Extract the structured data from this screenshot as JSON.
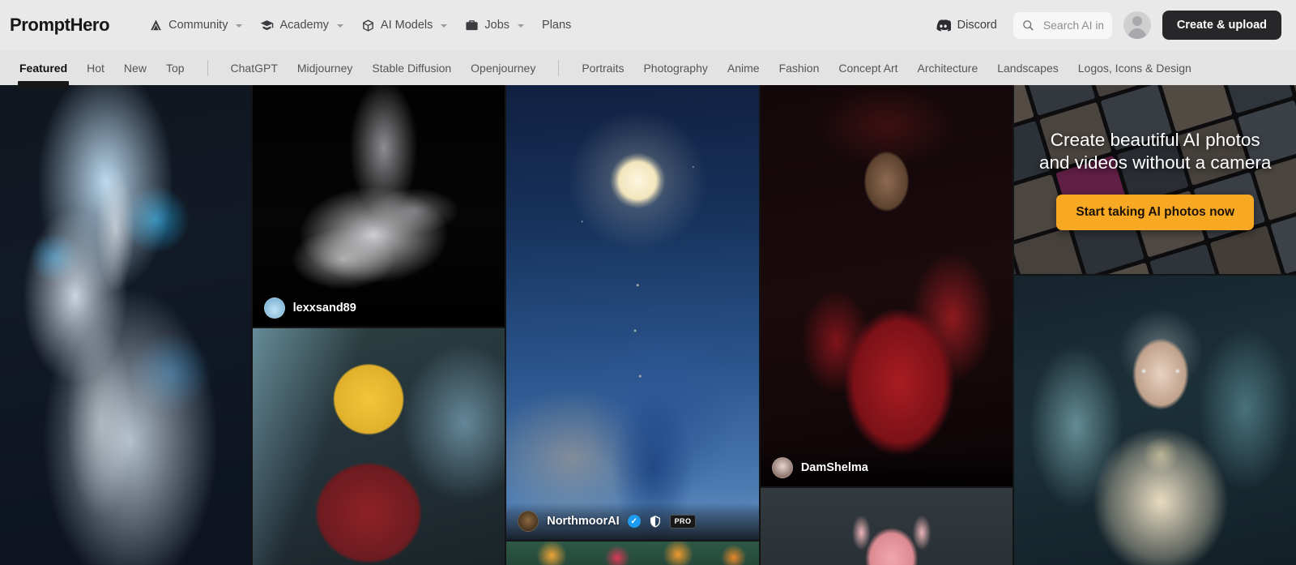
{
  "header": {
    "brand": "PromptHero",
    "nav": [
      {
        "label": "Community",
        "icon": "tent-icon",
        "has_caret": true
      },
      {
        "label": "Academy",
        "icon": "graduation-cap-icon",
        "has_caret": true
      },
      {
        "label": "AI Models",
        "icon": "cube-icon",
        "has_caret": true
      },
      {
        "label": "Jobs",
        "icon": "briefcase-icon",
        "has_caret": true
      },
      {
        "label": "Plans",
        "icon": "",
        "has_caret": false
      }
    ],
    "discord_label": "Discord",
    "discord_icon": "discord-icon",
    "search": {
      "value": "",
      "placeholder": "Search AI images",
      "icon": "search-icon"
    },
    "avatar_icon": "user-avatar-icon",
    "create_button": "Create & upload"
  },
  "subnav": {
    "sort_tabs": [
      {
        "label": "Featured",
        "active": true
      },
      {
        "label": "Hot",
        "active": false
      },
      {
        "label": "New",
        "active": false
      },
      {
        "label": "Top",
        "active": false
      }
    ],
    "model_tabs": [
      {
        "label": "ChatGPT"
      },
      {
        "label": "Midjourney"
      },
      {
        "label": "Stable Diffusion"
      },
      {
        "label": "Openjourney"
      }
    ],
    "category_tabs": [
      {
        "label": "Portraits"
      },
      {
        "label": "Photography"
      },
      {
        "label": "Anime"
      },
      {
        "label": "Fashion"
      },
      {
        "label": "Concept Art"
      },
      {
        "label": "Architecture"
      },
      {
        "label": "Landscapes"
      },
      {
        "label": "Logos, Icons & Design"
      }
    ]
  },
  "promo": {
    "title": "Create beautiful AI photos and videos without a camera",
    "cta_label": "Start taking AI photos now",
    "cta_color": "#f7a923"
  },
  "gallery": {
    "columns": [
      {
        "tiles": [
          {
            "name": "blue-mermaid-artwork",
            "user": null
          }
        ]
      },
      {
        "tiles": [
          {
            "name": "black-white-dancer-artwork",
            "user": {
              "name": "lexxsand89",
              "verified": false,
              "shield": false,
              "pro": false
            }
          },
          {
            "name": "homer-simpson-suit-artwork",
            "user": null
          }
        ]
      },
      {
        "tiles": [
          {
            "name": "girl-moon-lanterns-artwork",
            "user": {
              "name": "NorthmoorAI",
              "verified": true,
              "shield": true,
              "pro": true,
              "pro_label": "PRO"
            }
          },
          {
            "name": "orange-flowers-artwork",
            "user": null
          }
        ]
      },
      {
        "tiles": [
          {
            "name": "red-dress-woman-artwork",
            "user": {
              "name": "DamShelma",
              "verified": false,
              "shield": false,
              "pro": false
            }
          },
          {
            "name": "pink-creature-artwork",
            "user": null
          }
        ]
      },
      {
        "tiles": [
          {
            "name": "promo-banner",
            "user": null
          },
          {
            "name": "fantasy-elf-queen-artwork",
            "user": null
          }
        ]
      }
    ]
  },
  "colors": {
    "header_bg": "#e9e9e9",
    "subnav_bg": "#e3e3e3",
    "create_button_bg": "#27272a",
    "accent_orange": "#f7a923",
    "verified_blue": "#1d9bf0",
    "page_bg": "#0c0c0e"
  }
}
